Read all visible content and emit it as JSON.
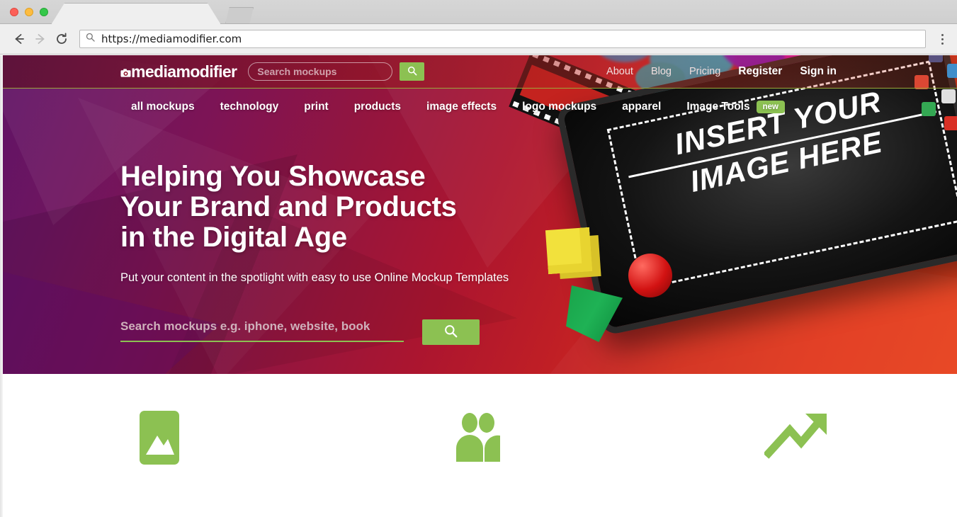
{
  "browser": {
    "tab_title": "",
    "url": "https://mediamodifier.com",
    "back_icon": "back-arrow-icon",
    "forward_icon": "forward-arrow-icon",
    "reload_icon": "reload-icon",
    "omnibox_icon": "search-icon",
    "menu_icon": "kebab-menu-icon",
    "window_controls": [
      "close",
      "minimize",
      "maximize"
    ]
  },
  "site": {
    "logo_text": "mediamodifier",
    "header_search": {
      "placeholder": "Search mockups",
      "value": ""
    },
    "header_search_button_icon": "search-icon",
    "header_links": [
      {
        "label": "About",
        "strong": false
      },
      {
        "label": "Blog",
        "strong": false
      },
      {
        "label": "Pricing",
        "strong": false
      },
      {
        "label": "Register",
        "strong": true
      },
      {
        "label": "Sign in",
        "strong": true
      }
    ],
    "nav": [
      {
        "label": "all mockups",
        "badge": ""
      },
      {
        "label": "technology",
        "badge": ""
      },
      {
        "label": "print",
        "badge": ""
      },
      {
        "label": "products",
        "badge": ""
      },
      {
        "label": "image effects",
        "badge": ""
      },
      {
        "label": "logo mockups",
        "badge": ""
      },
      {
        "label": "apparel",
        "badge": ""
      },
      {
        "label": "Image Tools",
        "badge": "new"
      }
    ]
  },
  "hero": {
    "headline_lines": [
      "Helping You Showcase",
      "Your Brand and Products",
      "in the Digital Age"
    ],
    "subheadline": "Put your content in the spotlight with easy to use Online Mockup Templates",
    "search": {
      "placeholder": "Search mockups e.g. iphone, website, book",
      "value": ""
    },
    "search_button_icon": "search-icon",
    "artwork_text_lines": [
      "INSERT YOUR",
      "IMAGE HERE"
    ]
  },
  "features": [
    {
      "icon": "image-icon",
      "title": ""
    },
    {
      "icon": "people-icon",
      "title": ""
    },
    {
      "icon": "trending-up-icon",
      "title": ""
    }
  ],
  "colors": {
    "accent_green": "#8cc152",
    "hero_left": "#5f1466",
    "hero_right": "#e8431f",
    "header_rule": "#9aa83a"
  }
}
